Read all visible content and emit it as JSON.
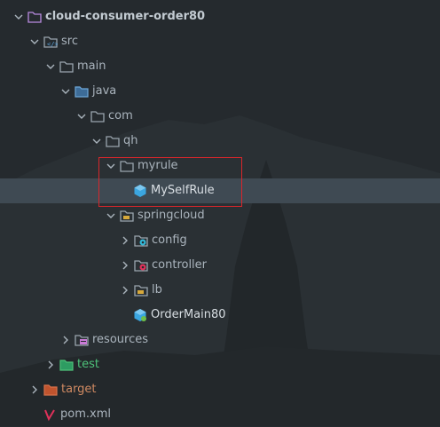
{
  "tree": {
    "root": {
      "label": "cloud-consumer-order80",
      "expanded": true
    },
    "src": {
      "label": "src",
      "expanded": true
    },
    "main": {
      "label": "main",
      "expanded": true
    },
    "java": {
      "label": "java",
      "expanded": true
    },
    "com": {
      "label": "com",
      "expanded": true
    },
    "qh": {
      "label": "qh",
      "expanded": true
    },
    "myrule": {
      "label": "myrule",
      "expanded": true
    },
    "myselfrule": {
      "label": "MySelfRule",
      "selected": true
    },
    "springcloud": {
      "label": "springcloud",
      "expanded": true
    },
    "config": {
      "label": "config",
      "expanded": false
    },
    "controller": {
      "label": "controller",
      "expanded": false
    },
    "lb": {
      "label": "lb",
      "expanded": false
    },
    "ordermain80": {
      "label": "OrderMain80"
    },
    "resources": {
      "label": "resources",
      "expanded": false
    },
    "test": {
      "label": "test",
      "expanded": false
    },
    "target": {
      "label": "target",
      "expanded": false
    },
    "pom": {
      "label": "pom.xml"
    }
  },
  "colors": {
    "background": "#252a2e",
    "text": "#aab4bd",
    "root_text": "#c3cbd2",
    "class_text": "#d9dfe4",
    "test_text": "#4ec27a",
    "target_text": "#d08a62",
    "selection": "#3f4a53",
    "highlight_border": "#d8262b",
    "folder_icon": "#9aa5ae",
    "class_icon": "#3ba6e0",
    "maven_icon": "#e0315a"
  },
  "icons": {
    "module": "module-folder-icon",
    "source_root": "source-root-folder-icon",
    "folder": "folder-icon",
    "package": "package-icon",
    "class": "class-icon",
    "spring_config": "spring-config-package-icon",
    "spring_controller": "spring-controller-package-icon",
    "spring_boot_main": "spring-boot-class-icon",
    "resources": "resources-folder-icon",
    "test_root": "test-root-folder-icon",
    "excluded": "excluded-folder-icon",
    "maven": "maven-icon",
    "chevron_down": "chevron-down-icon",
    "chevron_right": "chevron-right-icon"
  }
}
